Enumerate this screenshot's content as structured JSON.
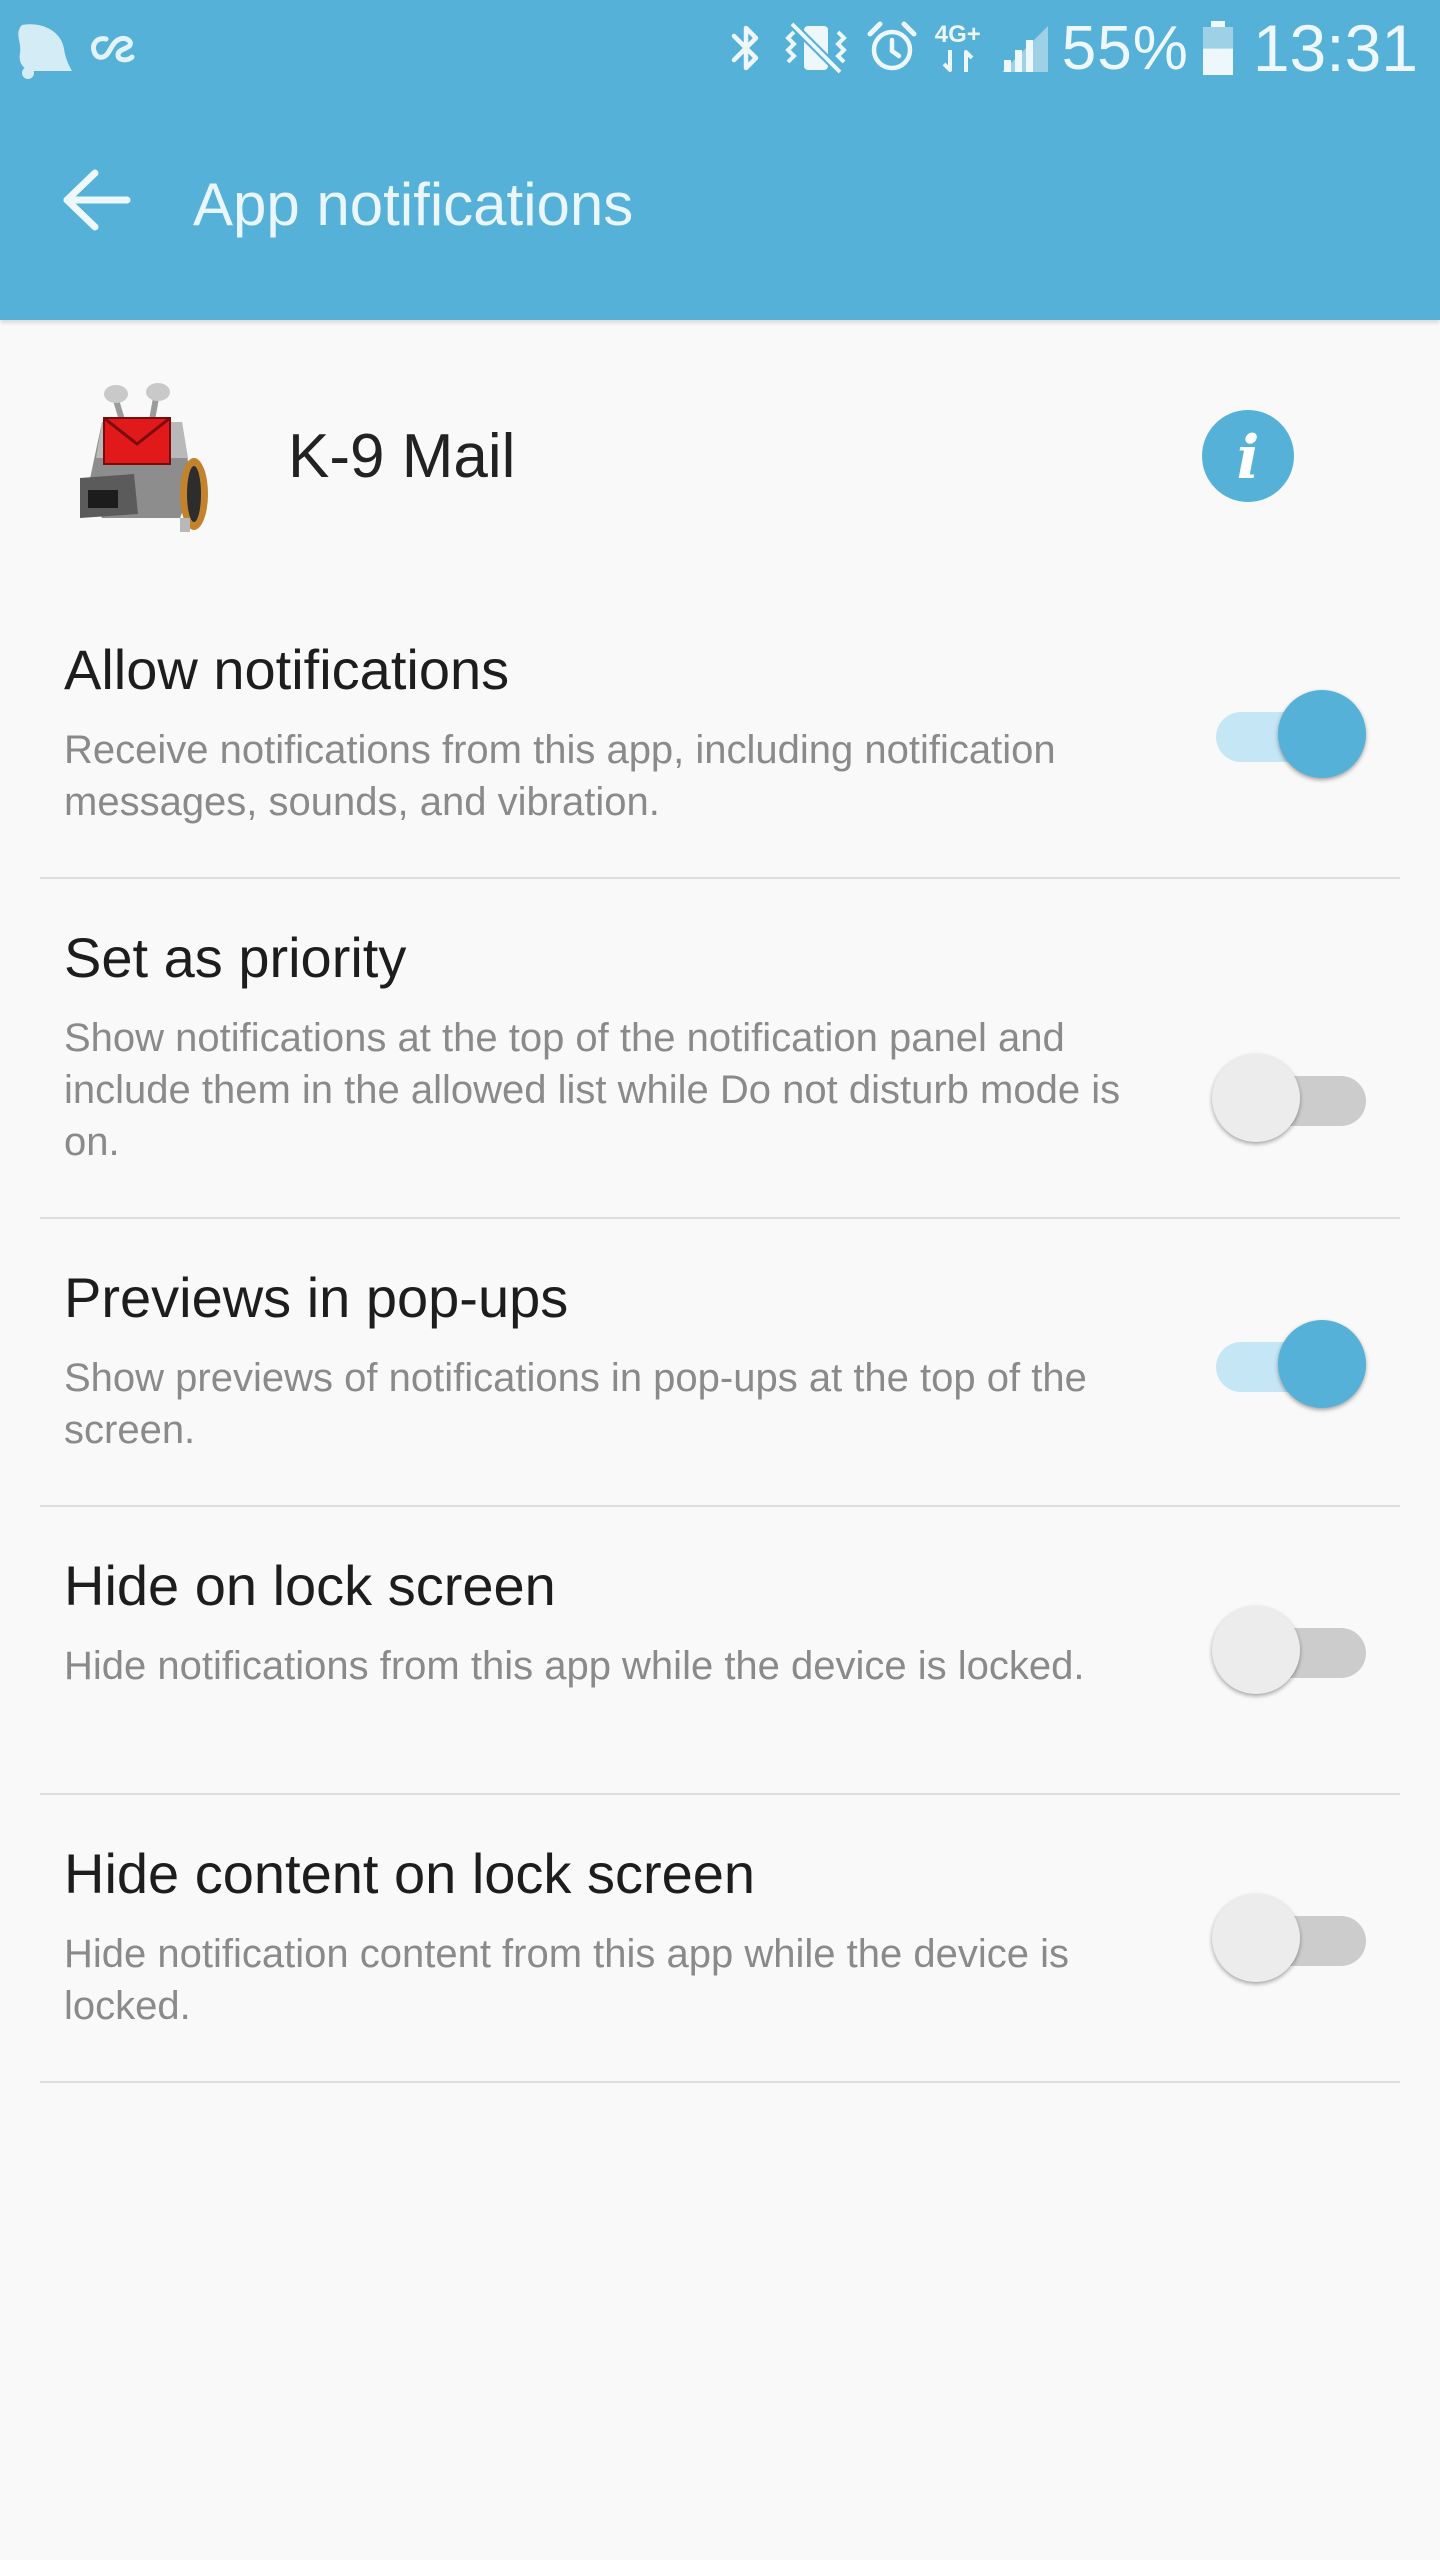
{
  "status_bar": {
    "left_icons": [
      "notification-bell-icon",
      "os-logo-icon"
    ],
    "right_icons": [
      "bluetooth-icon",
      "vibrate-mute-icon",
      "alarm-icon",
      "4g-plus-data-icon",
      "signal-icon"
    ],
    "network_label": "4G+",
    "battery_percent": "55%",
    "battery_level": 0.55,
    "time": "13:31"
  },
  "app_bar": {
    "back_icon": "back-arrow-icon",
    "title": "App notifications",
    "background_color": "#55b1d7"
  },
  "app": {
    "name": "K-9 Mail",
    "icon": "k9-mail-app-icon",
    "info_icon": "info-icon",
    "info_glyph": "i"
  },
  "settings": [
    {
      "title": "Allow notifications",
      "description": "Receive notifications from this app, including notification messages, sounds, and vibration.",
      "enabled": true
    },
    {
      "title": "Set as priority",
      "description": "Show notifications at the top of the notification panel and include them in the allowed list while Do not disturb mode is on.",
      "enabled": false
    },
    {
      "title": "Previews in pop-ups",
      "description": "Show previews of notifications in pop-ups at the top of the screen.",
      "enabled": true
    },
    {
      "title": "Hide on lock screen",
      "description": "Hide notifications from this app while the device is locked.",
      "enabled": false
    },
    {
      "title": "Hide content on lock screen",
      "description": "Hide notification content from this app while the device is locked.",
      "enabled": false
    }
  ],
  "colors": {
    "accent": "#55b1d7",
    "toggle_on_track": "#c5e6f4",
    "toggle_off_track": "#cccccc",
    "toggle_off_thumb": "#ececec",
    "background": "#f9f9f9"
  }
}
